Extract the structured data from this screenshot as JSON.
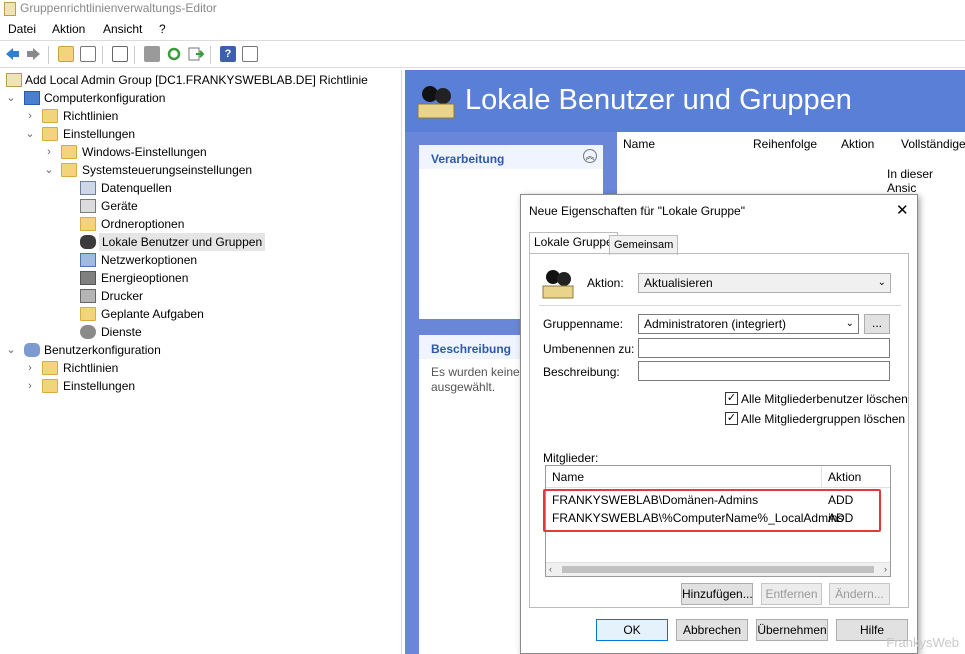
{
  "window": {
    "title": "Gruppenrichtlinienverwaltungs-Editor"
  },
  "menu": {
    "items": [
      "Datei",
      "Aktion",
      "Ansicht",
      "?"
    ]
  },
  "toolbar": {
    "icons": [
      "back-icon",
      "forward-icon",
      "up-folder-icon",
      "show-hide-tree-icon",
      "properties-icon",
      "print-icon",
      "refresh-icon",
      "export-icon",
      "help-icon",
      "view-icon"
    ]
  },
  "tree": {
    "root": "Add Local Admin Group [DC1.FRANKYSWEBLAB.DE] Richtlinie",
    "items": [
      "Computerkonfiguration",
      "Richtlinien",
      "Einstellungen",
      "Windows-Einstellungen",
      "Systemsteuerungseinstellungen",
      "Datenquellen",
      "Geräte",
      "Ordneroptionen",
      "Lokale Benutzer und Gruppen",
      "Netzwerkoptionen",
      "Energieoptionen",
      "Drucker",
      "Geplante Aufgaben",
      "Dienste",
      "Benutzerkonfiguration",
      "Richtlinien",
      "Einstellungen"
    ]
  },
  "right": {
    "title": "Lokale Benutzer und Gruppen",
    "panel1": "Verarbeitung",
    "panel2": "Beschreibung",
    "panel2_text1": "Es wurden keine",
    "panel2_text2": "ausgewählt.",
    "columns": [
      "Name",
      "Reihenfolge",
      "Aktion",
      "Vollständige"
    ],
    "empty_text": "In dieser Ansic"
  },
  "dialog": {
    "title": "Neue Eigenschaften für \"Lokale Gruppe\"",
    "close": "✕",
    "tabs": [
      "Lokale Gruppe",
      "Gemeinsam"
    ],
    "action_label": "Aktion:",
    "action_value": "Aktualisieren",
    "groupname_label": "Gruppenname:",
    "groupname_value": "Administratoren (integriert)",
    "browse": "...",
    "rename_label": "Umbenennen zu:",
    "rename_value": "",
    "desc_label": "Beschreibung:",
    "desc_value": "",
    "chk1": "Alle Mitgliederbenutzer löschen",
    "chk2": "Alle Mitgliedergruppen löschen",
    "members_label": "Mitglieder:",
    "members_cols": [
      "Name",
      "Aktion"
    ],
    "members": [
      {
        "name": "FRANKYSWEBLAB\\Domänen-Admins",
        "action": "ADD"
      },
      {
        "name": "FRANKYSWEBLAB\\%ComputerName%_LocalAdmins",
        "action": "ADD"
      }
    ],
    "add": "Hinzufügen...",
    "remove": "Entfernen",
    "change": "Ändern...",
    "ok": "OK",
    "cancel": "Abbrechen",
    "apply": "Übernehmen",
    "help": "Hilfe"
  },
  "watermark": "FrankysWeb"
}
